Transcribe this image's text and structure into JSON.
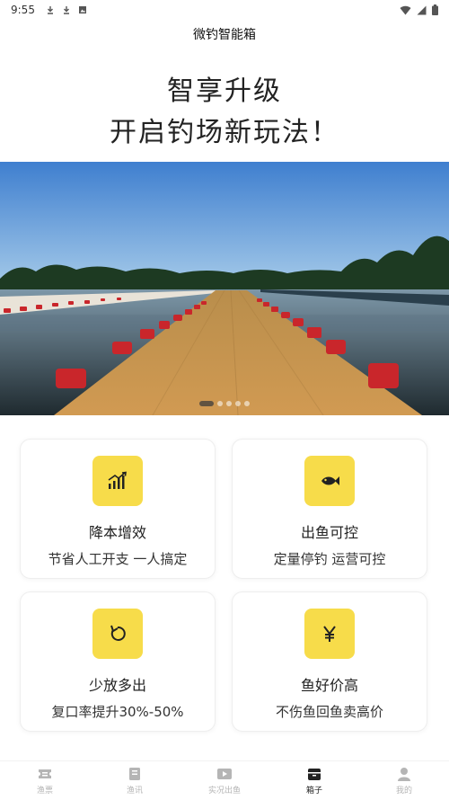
{
  "status_bar": {
    "time": "9:55"
  },
  "app": {
    "title": "微钓智能箱"
  },
  "headline": {
    "line1": "智享升级",
    "line2": "开启钓场新玩法！"
  },
  "banner": {
    "slides": 5,
    "active_index": 0
  },
  "features": [
    {
      "icon": "chart-growth-icon",
      "title": "降本增效",
      "subtitle": "节省人工开支 一人搞定"
    },
    {
      "icon": "fish-icon",
      "title": "出鱼可控",
      "subtitle": "定量停钓 运营可控"
    },
    {
      "icon": "refresh-icon",
      "title": "少放多出",
      "subtitle": "复口率提升30%-50%"
    },
    {
      "icon": "yen-icon",
      "title": "鱼好价高",
      "subtitle": "不伤鱼回鱼卖高价"
    }
  ],
  "tabbar": {
    "items": [
      {
        "label": "渔票",
        "icon": "ticket-icon"
      },
      {
        "label": "渔讯",
        "icon": "news-icon"
      },
      {
        "label": "实况出鱼",
        "icon": "video-icon"
      },
      {
        "label": "箱子",
        "icon": "box-icon",
        "active": true
      },
      {
        "label": "我的",
        "icon": "profile-icon"
      }
    ]
  },
  "colors": {
    "accent": "#f7dc4a",
    "tab_active": "#222222",
    "tab_inactive": "#b5b5b5"
  }
}
